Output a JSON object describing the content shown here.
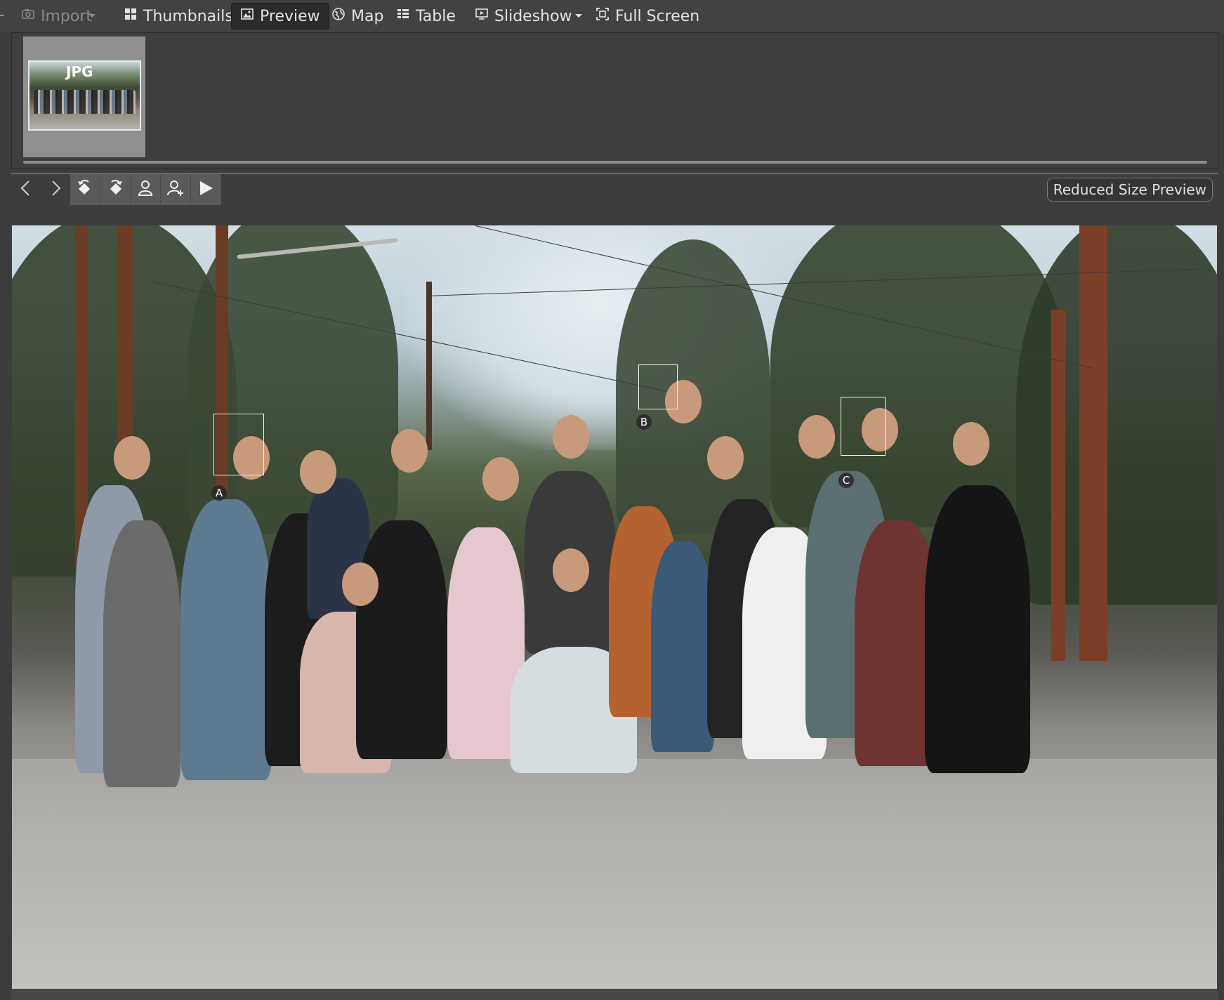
{
  "toolbar": {
    "import_label": "Import",
    "thumbnails_label": "Thumbnails",
    "preview_label": "Preview",
    "map_label": "Map",
    "table_label": "Table",
    "slideshow_label": "Slideshow",
    "fullscreen_label": "Full Screen",
    "active_view": "Preview"
  },
  "thumbnail_strip": {
    "items": [
      {
        "badge": "JPG",
        "selected": true
      }
    ]
  },
  "preview": {
    "mode_label": "Reduced Size Preview",
    "toolbar_icons": [
      "back-arrow-icon",
      "forward-arrow-icon",
      "rotate-left-icon",
      "rotate-right-icon",
      "person-icon",
      "add-person-icon",
      "play-icon"
    ],
    "face_tags": [
      {
        "label": "A"
      },
      {
        "label": "B"
      },
      {
        "label": "C"
      }
    ]
  },
  "colors": {
    "background": "#3c3c3c",
    "toolbar": "#424242",
    "active_tab": "#2b2b2b",
    "accent_border": "#4a6aa0"
  }
}
